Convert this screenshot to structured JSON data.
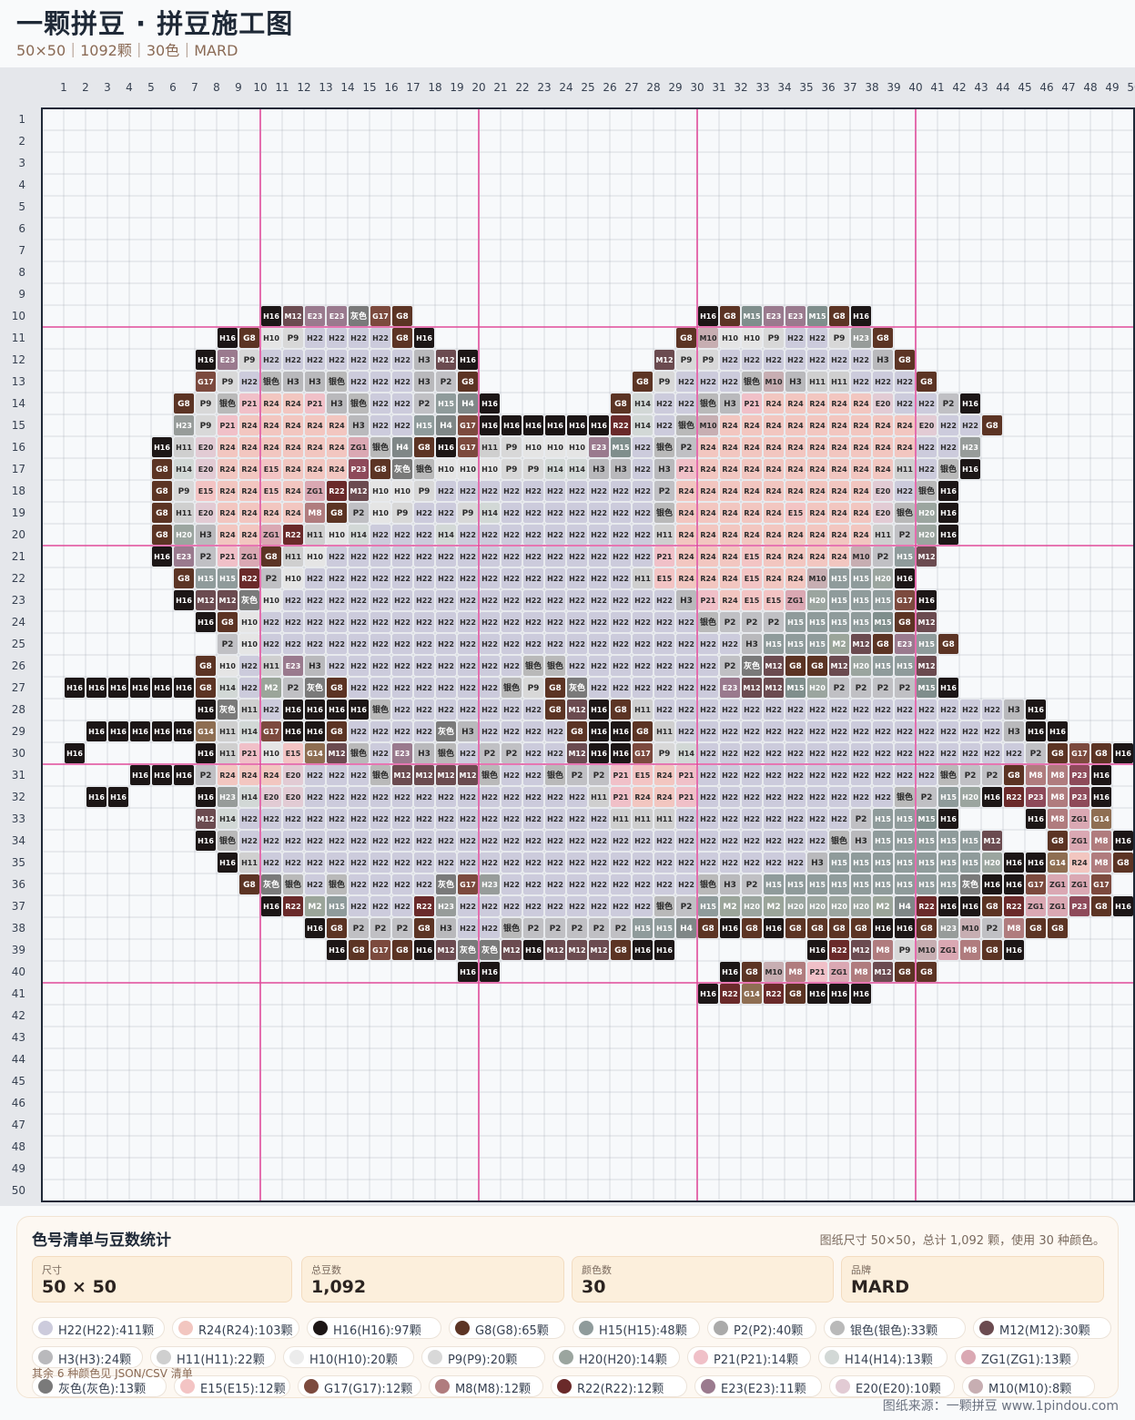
{
  "header": {
    "title": "一颗拼豆 · 拼豆施工图",
    "subtitle": "50×50｜1092颗｜30色｜MARD"
  },
  "grid": {
    "cols": 50,
    "rows": 50,
    "major_line_color": "#e04a9a",
    "minor_line_color": "#9ca3af",
    "palette": {
      "H22": "#cccbdc",
      "R24": "#f2c6c0",
      "H16": "#1c1616",
      "G8": "#5c3424",
      "H15": "#8f9b9b",
      "P2": "#c0c0c4",
      "银色": "#b9b9b9",
      "M12": "#6b4b50",
      "H3": "#b9b9bc",
      "H11": "#cfcfcf",
      "H10": "#e5e5e5",
      "P9": "#d8d8d8",
      "H20": "#9ba59f",
      "P21": "#f0c0c8",
      "H14": "#d2d8d6",
      "ZG1": "#daa8b3",
      "灰色": "#7a7a7a",
      "E15": "#f3c4c4",
      "G17": "#7c4a3e",
      "M8": "#b07c7e",
      "R22": "#6a2a2a",
      "E23": "#9a7a8e",
      "E20": "#e2cbd4",
      "M10": "#c7aeb2",
      "H23": "#979c9a",
      "M15": "#7f8e8c",
      "G14": "#8e6e52",
      "H4": "#7f8787",
      "P23": "#8e4a5a",
      "M2": "#9ba59a"
    },
    "light_codes": [
      "H22",
      "R24",
      "P2",
      "银色",
      "H3",
      "H11",
      "H10",
      "P9",
      "P21",
      "H14",
      "ZG1",
      "E15",
      "E20",
      "M10"
    ],
    "rows_data": [
      "",
      "",
      "",
      "",
      "",
      "",
      "",
      "",
      "",
      "11:H16 M12 E23 E23 灰色 G17 G8|31:H16 G8 M15 E23 E23 M15 G8 H16",
      "9:H16 G8 H10 P9 H22 H22 H22 H22 G8 H16|30:G8 M10 H10 H10 P9 H22 H22 P9 H23 G8",
      "8:H16 E23 P9 H22 H22 H22 H22 H22 H22 H22 H3 M12 H16|29:M12 P9 P9 H22 H22 H22 H22 H22 H22 H22 H3 G8",
      "8:G17 P9 H22 银色 H3 H3 银色 H22 H22 H22 H3 P2 G8|28:G8 P9 H22 H22 H22 银色 M10 H3 H11 H11 H22 H22 H22 G8",
      "7:G8 P9 银色 P21 R24 R24 P21 H3 银色 H22 H22 P2 H15 H4 H16|27:G8 H14 H22 H22 银色 H3 P21 R24 R24 R24 R24 R24 E20 H22 H22 P2 H16",
      "7:H23 P9 P21 R24 R24 R24 R24 R24 H3 H22 H22 H15 H4 G17 H16 H16 H16 H16 H16 H16 R22 H14 H22 银色 M10 R24 R24 R24 R24 R24 R24 R24 R24 R24 E20 H22 H22 G8",
      "6:H16 H11 E20 R24 R24 R24 R24 R24 R24 ZG1 银色 H4 G8 H16 G17 H11 P9 H10 H10 H10 E23 M15 H22 银色 P2 R24 R24 R24 R24 R24 R24 R24 R24 R24 R24 H22 H22 H23",
      "6:G8 H14 E20 R24 R24 E15 R24 R24 R24 P23 G8 灰色 银色 H10 H10 H10 P9 P9 H14 H14 H3 H3 H22 H3 P21 R24 R24 R24 R24 R24 R24 R24 R24 R24 H11 H22 银色 H16",
      "6:G8 P9 E15 R24 R24 E15 R24 ZG1 R22 M12 H10 H10 P9 H22 H22 H22 H22 H22 H22 H22 H22 H22 H22 P2 R24 R24 R24 R24 R24 R24 R24 R24 R24 E20 H22 银色 H16",
      "6:G8 H11 E20 R24 R24 R24 R24 M8 G8 P2 H10 P9 H22 H22 P9 H14 H22 H22 H22 H22 H22 H22 H22 银色 R24 R24 R24 R24 R24 E15 R24 R24 R24 E20 银色 H20 H16",
      "6:G8 H20 H3 R24 R24 ZG1 R22 H11 H10 H14 H22 H22 H22 H14 H22 H22 H22 H22 H22 H22 H22 H22 H22 H11 R24 R24 R24 R24 R24 R24 R24 R24 R24 H11 P2 H20 H16",
      "6:H16 E23 P2 P21 ZG1 G8 H11 H10 H22 H22 H22 H22 H22 H22 H22 H22 H22 H22 H22 H22 H22 H22 H22 P21 R24 R24 R24 E15 R24 R24 R24 R24 M10 P2 H15 M12",
      "7:G8 H15 H15 R22 P2 H10 H22 H22 H22 H22 H22 H22 H22 H22 H22 H22 H22 H22 H22 H22 H22 H11 E15 R24 R24 R24 E15 R24 R24 M10 H15 H15 H20 H16",
      "7:H16 M12 M12 灰色 H10 H22 H22 H22 H22 H22 H22 H22 H22 H22 H22 H22 H22 H22 H22 H22 H22 H22 H22 H3 P21 R24 E15 E15 ZG1 H20 H15 H15 H15 G17 H16",
      "8:H16 G8 H10 H22 H22 H22 H22 H22 H22 H22 H22 H22 H22 H22 H22 H22 H22 H22 H22 H22 H22 H22 H22 银色 P2 P2 P2 H15 H15 H15 H15 M15 G8 M12",
      "9:P2 H10 H22 H22 H22 H22 H22 H22 H22 H22 H22 H22 H22 H22 H22 H22 H22 H22 H22 H22 H22 H22 H22 H22 H3 H15 H15 H15 M2 M12 G8 E23 H15 G8",
      "8:G8 H10 H22 H11 E23 H3 H22 H22 H22 H22 H22 H22 H22 H22 H22 银色 银色 H22 H22 H22 H22 H22 H22 H22 P2 灰色 M12 G8 G8 M12 H20 H15 H15 M12",
      "2:H16 H16 H16 H16 H16 H16 G8 H14 H22 M2 P2 灰色 G8 H22 H22 H22 H22 H22 H22 H22 银色 P9 G8 灰色 H22 H22 H22 H22 H22 H22 E23 M12 M12 M15 H20 P2 P2 P2 P2 M15 H16",
      "8:H16 灰色 H11 H22 H16 H16 H16 H16 银色 H22 H22 H22 H22 H22 H22 H22 G8 M12 H16 G8 H11 H22 H22 H22 H22 H22 H22 H22 H22 H22 H22 H22 H22 H22 H22 H22 H22 H3 H16",
      "3:H16 H16 H16 H16 H16 G14 H11 H14 G17 H16 H16 G8 H22 H22 H22 H22 灰色 H3 H22 H22 H22 H22 G8 H16 H16 G8 H11 H22 H22 H22 H22 H22 H22 H22 H22 H22 H22 H22 H22 H22 H22 H22 H3 H16 H16",
      "2:H16|8:H16 H11 P21 H10 E15 G14 M12 银色 H22 E23 H3 银色 H22 P2 P2 H22 H22 M12 H16 H16 G17 P9 H14 H22 H22 H22 H22 H22 H22 H22 H22 H22 H22 H22 H22 H22 H22 H22 P2 G8 G17 G8 H16",
      "5:H16 H16 H16 P2 R24 R24 R24 E20 H22 H22 H22 银色 M12 M12 M12 M12 银色 H22 H22 银色 P2 P2 P21 E15 R24 P21 H22 H22 H22 H22 H22 H22 H22 H22 H22 H22 H22 银色 P2 P2 G8 M8 M8 P23 H16",
      "3:H16 H16|8:H16 H23 H14 E20 E20 H22 H22 H22 H22 H22 H22 H22 H22 H22 H22 H22 H22 H22 H11 P21 R24 R24 P21 H22 H22 H22 H22 H22 H22 H22 H22 H22 银色 P2 H15 H20 H16 R22 P23 M8 P23 H16",
      "8:M12 H14 H22 H22 H22 H22 H22 H22 H22 H22 H22 H22 H22 H22 H22 H22 H22 H22 H22 H11 H11 H11 H22 H22 H22 H22 H22 H22 H22 H22 P2 H15 H15 M15 H16|46:H16 M8 ZG1 G14",
      "8:H16 银色 H22 H22 H22 H22 H22 H22 H22 H22 H22 H22 H22 H22 H22 H22 H22 H22 H22 H22 H22 H22 H22 H22 H22 H22 H22 H22 H22 银色 H3 H15 H15 H15 H15 H15 M12|47:G8 ZG1 M8 H16",
      "9:H16 H11 H22 H22 H22 H22 H22 H22 H22 H22 H22 H22 H22 H22 H22 H22 H22 H22 H22 H22 H22 H22 H22 H22 H22 H22 H22 H3 H15 H15 H15 H15 H15 H15 H15 H20 H16|46:H16 G14 R24 M8 G8",
      "10:G8 灰色 银色 H22 银色 H22 H22 H22 H22 灰色 G17 H23 H22 H22 H22 H22 H22 H22 H22 H22 H22 银色 H3 P2 H15 H15 H15 H15 H15 H15 H15 H15 H15 灰色 H16|45:H16 G17 ZG1 ZG1 G17",
      "11:H16 R22 M2 H15 H22 H22 H22 R22 H23 H22 H22 H22 H22 H22 H22 H22 H22 H22 银色 P2 H15 M2 H20 M2 H20 H20 H20 H20 M2 H4 R22 H16 H16 G8 R22 ZG1 ZG1 P23 G8 H16",
      "13:H16 G8 P2 P2 P2 G8 H3 H22 H22 银色 P2 P2 P2 P2 P2 H15 H15 H4 G8 H16 G8 H16 G8 G8 G8 G8 H16 H16 G8 H23 M10 P2 M8 G8 G8",
      "14:H16 G8 G17 G8 H16 M12 灰色 灰色 M12 H16 M12 M12 M12 G8 H16 H16|36:H16 R22 M12 M8 P9 M10 ZG1 M8 G8 H16",
      "20:H16 H16|32:H16 G8 M10 M8 P21 ZG1 M8 M12 G8 G8",
      "31:H16 R22 G14 R22 G8 H16 H16 H16",
      "",
      "",
      "",
      "",
      "",
      "",
      "",
      "",
      ""
    ]
  },
  "legend": {
    "title": "色号清单与豆数统计",
    "note": "图纸尺寸 50×50，总计 1,092 颗，使用 30 种颜色。",
    "stats": [
      {
        "label": "尺寸",
        "value": "50 × 50"
      },
      {
        "label": "总豆数",
        "value": "1,092"
      },
      {
        "label": "颜色数",
        "value": "30"
      },
      {
        "label": "品牌",
        "value": "MARD"
      }
    ],
    "chips": [
      {
        "text": "H22(H22):411颗",
        "color": "#cccbdc"
      },
      {
        "text": "R24(R24):103颗",
        "color": "#f2c6c0"
      },
      {
        "text": "H16(H16):97颗",
        "color": "#1c1616"
      },
      {
        "text": "G8(G8):65颗",
        "color": "#5c3424"
      },
      {
        "text": "H15(H15):48颗",
        "color": "#8f9b9b"
      },
      {
        "text": "P2(P2):40颗",
        "color": "#aaaaaa"
      },
      {
        "text": "银色(银色):33颗",
        "color": "#b9b9b9"
      },
      {
        "text": "M12(M12):30颗",
        "color": "#6b4b50"
      },
      {
        "text": "H3(H3):24颗",
        "color": "#b9b9bc"
      },
      {
        "text": "H11(H11):22颗",
        "color": "#cfcfcf"
      },
      {
        "text": "H10(H10):20颗",
        "color": "#ececec"
      },
      {
        "text": "P9(P9):20颗",
        "color": "#d8d8d8"
      },
      {
        "text": "H20(H20):14颗",
        "color": "#9ba59f"
      },
      {
        "text": "P21(P21):14颗",
        "color": "#f0c0c8"
      },
      {
        "text": "H14(H14):13颗",
        "color": "#d2d8d6"
      },
      {
        "text": "ZG1(ZG1):13颗",
        "color": "#daa8b3"
      },
      {
        "text": "灰色(灰色):13颗",
        "color": "#7a7a7a"
      },
      {
        "text": "E15(E15):12颗",
        "color": "#f3c4c4"
      },
      {
        "text": "G17(G17):12颗",
        "color": "#7c4a3e"
      },
      {
        "text": "M8(M8):12颗",
        "color": "#b07c7e"
      },
      {
        "text": "R22(R22):12颗",
        "color": "#6a2a2a"
      },
      {
        "text": "E23(E23):11颗",
        "color": "#9a7a8e"
      },
      {
        "text": "E20(E20):10颗",
        "color": "#e2cbd4"
      },
      {
        "text": "M10(M10):8颗",
        "color": "#c7aeb2"
      }
    ],
    "others": "其余 6 种颜色见 JSON/CSV 清单"
  },
  "footer": {
    "source": "图纸来源：一颗拼豆 www.1pindou.com"
  }
}
